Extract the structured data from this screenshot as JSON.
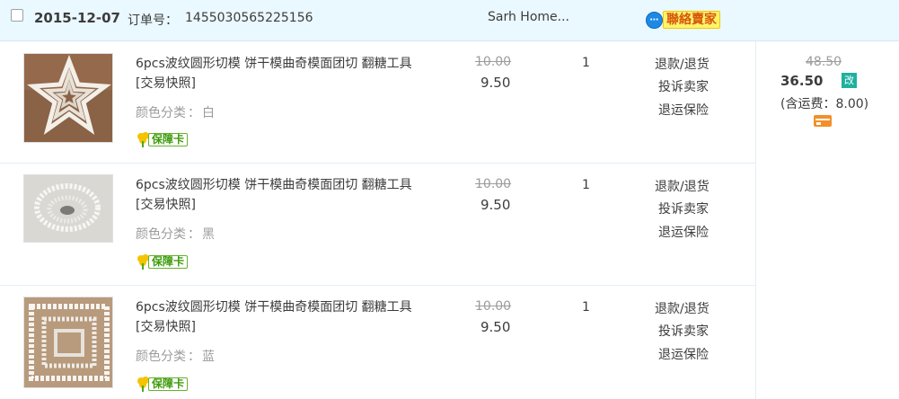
{
  "order": {
    "date": "2015-12-07",
    "order_no_label": "订单号：",
    "order_no": "1455030565225156",
    "shop_name": "Sarh Home...",
    "contact_seller_label": "聯絡賣家",
    "total_original": "48.50",
    "total_now": "36.50",
    "modified_badge": "改",
    "shipping_text": "(含运费：8.00)"
  },
  "items": [
    {
      "title": "6pcs波纹圆形切模 饼干模曲奇模面团切 翻糖工具[交易快照]",
      "sku_label": "颜色分类",
      "sku_value": "白",
      "guarantee_label": "保障卡",
      "price_original": "10.00",
      "price_now": "9.50",
      "quantity": "1",
      "ops": [
        "退款/退货",
        "投诉卖家",
        "退运保险"
      ]
    },
    {
      "title": "6pcs波纹圆形切模 饼干模曲奇模面团切 翻糖工具[交易快照]",
      "sku_label": "颜色分类",
      "sku_value": "黑",
      "guarantee_label": "保障卡",
      "price_original": "10.00",
      "price_now": "9.50",
      "quantity": "1",
      "ops": [
        "退款/退货",
        "投诉卖家",
        "退运保险"
      ]
    },
    {
      "title": "6pcs波纹圆形切模 饼干模曲奇模面团切 翻糖工具[交易快照]",
      "sku_label": "颜色分类",
      "sku_value": "蓝",
      "guarantee_label": "保障卡",
      "price_original": "10.00",
      "price_now": "9.50",
      "quantity": "1",
      "ops": [
        "退款/退货",
        "投诉卖家",
        "退运保险"
      ]
    }
  ],
  "icons": {
    "contact": "contact-seller-icon",
    "guarantee": "guarantee-flower-icon",
    "payment": "payment-card-icon"
  },
  "colors": {
    "header_bg": "#eaf8ff",
    "modified_badge": "#1fb19e",
    "guarantee_green": "#3d9b0b",
    "contact_yellow": "#fff36b",
    "payment_orange": "#f38f28"
  }
}
